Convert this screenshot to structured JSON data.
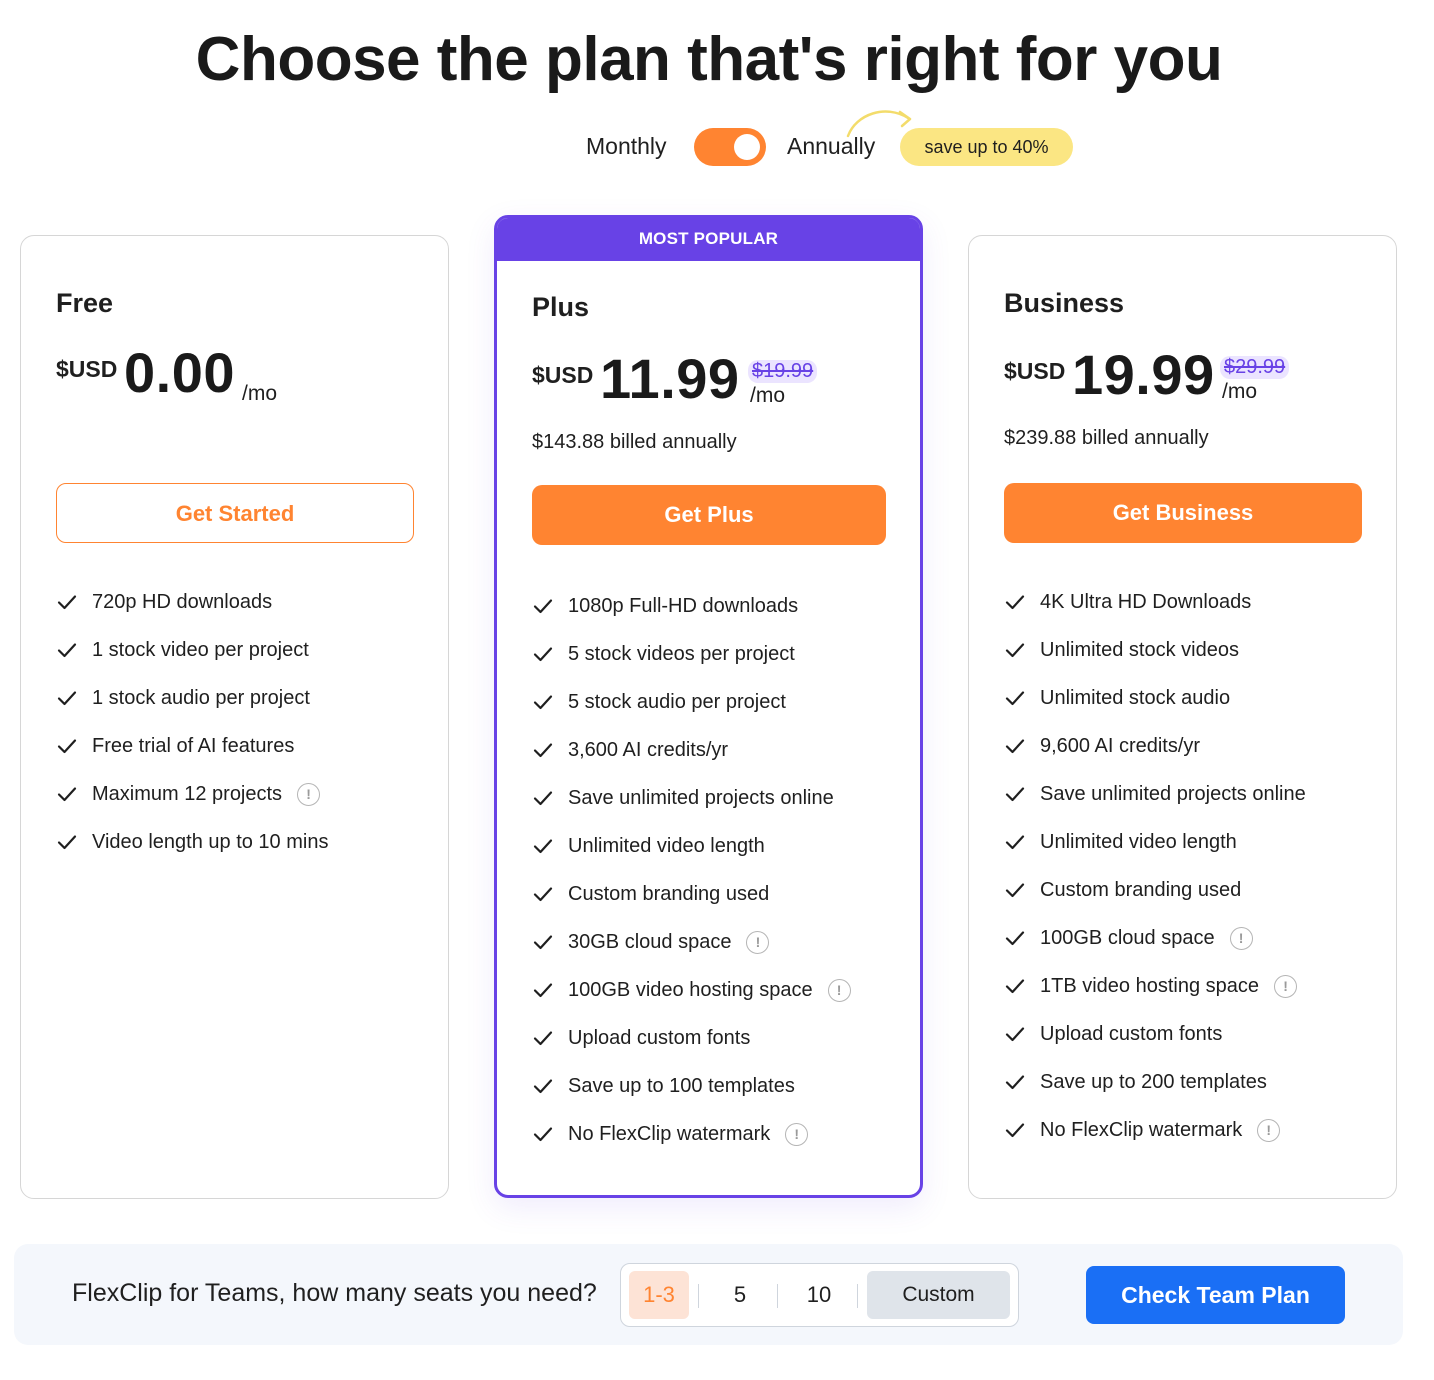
{
  "title": "Choose the plan that's right for you",
  "billing_toggle": {
    "monthly_label": "Monthly",
    "annually_label": "Annually",
    "selected": "Annually",
    "save_badge": "save up to 40%"
  },
  "colors": {
    "accent_orange": "#ff8431",
    "popular_purple": "#6842e6",
    "team_blue": "#1a6ff5",
    "save_yellow": "#fbe683"
  },
  "plans": [
    {
      "name": "Free",
      "currency": "$USD",
      "price": "0.00",
      "period": "/mo",
      "cta": "Get Started",
      "features": [
        {
          "text": "720p HD downloads",
          "info": false
        },
        {
          "text": "1 stock video per project",
          "info": false
        },
        {
          "text": "1 stock audio per project",
          "info": false
        },
        {
          "text": "Free trial of AI features",
          "info": false
        },
        {
          "text": "Maximum 12 projects",
          "info": true
        },
        {
          "text": "Video length up to 10 mins",
          "info": false
        }
      ]
    },
    {
      "name": "Plus",
      "badge": "MOST POPULAR",
      "currency": "$USD",
      "price": "11.99",
      "old_price": "$19.99",
      "period": "/mo",
      "billed": "$143.88 billed annually",
      "cta": "Get Plus",
      "features": [
        {
          "text": "1080p Full-HD downloads",
          "info": false
        },
        {
          "text": "5 stock videos per project",
          "info": false
        },
        {
          "text": "5 stock audio per project",
          "info": false
        },
        {
          "text": "3,600 AI credits/yr",
          "info": false
        },
        {
          "text": "Save unlimited projects online",
          "info": false
        },
        {
          "text": "Unlimited video length",
          "info": false
        },
        {
          "text": "Custom branding used",
          "info": false
        },
        {
          "text": "30GB cloud space",
          "info": true
        },
        {
          "text": "100GB video hosting space",
          "info": true
        },
        {
          "text": "Upload custom fonts",
          "info": false
        },
        {
          "text": "Save up to 100 templates",
          "info": false
        },
        {
          "text": "No FlexClip watermark",
          "info": true
        }
      ]
    },
    {
      "name": "Business",
      "currency": "$USD",
      "price": "19.99",
      "old_price": "$29.99",
      "period": "/mo",
      "billed": "$239.88 billed annually",
      "cta": "Get Business",
      "features": [
        {
          "text": "4K Ultra HD Downloads",
          "info": false
        },
        {
          "text": "Unlimited stock videos",
          "info": false
        },
        {
          "text": "Unlimited stock audio",
          "info": false
        },
        {
          "text": "9,600 AI credits/yr",
          "info": false
        },
        {
          "text": "Save unlimited projects online",
          "info": false
        },
        {
          "text": "Unlimited video length",
          "info": false
        },
        {
          "text": "Custom branding used",
          "info": false
        },
        {
          "text": "100GB cloud space",
          "info": true
        },
        {
          "text": "1TB video hosting space",
          "info": true
        },
        {
          "text": "Upload custom fonts",
          "info": false
        },
        {
          "text": "Save up to 200 templates",
          "info": false
        },
        {
          "text": "No FlexClip watermark",
          "info": true
        }
      ]
    }
  ],
  "teams": {
    "question": "FlexClip for Teams, how many seats you need?",
    "options": [
      "1-3",
      "5",
      "10",
      "Custom"
    ],
    "selected": "1-3",
    "cta": "Check Team Plan"
  }
}
